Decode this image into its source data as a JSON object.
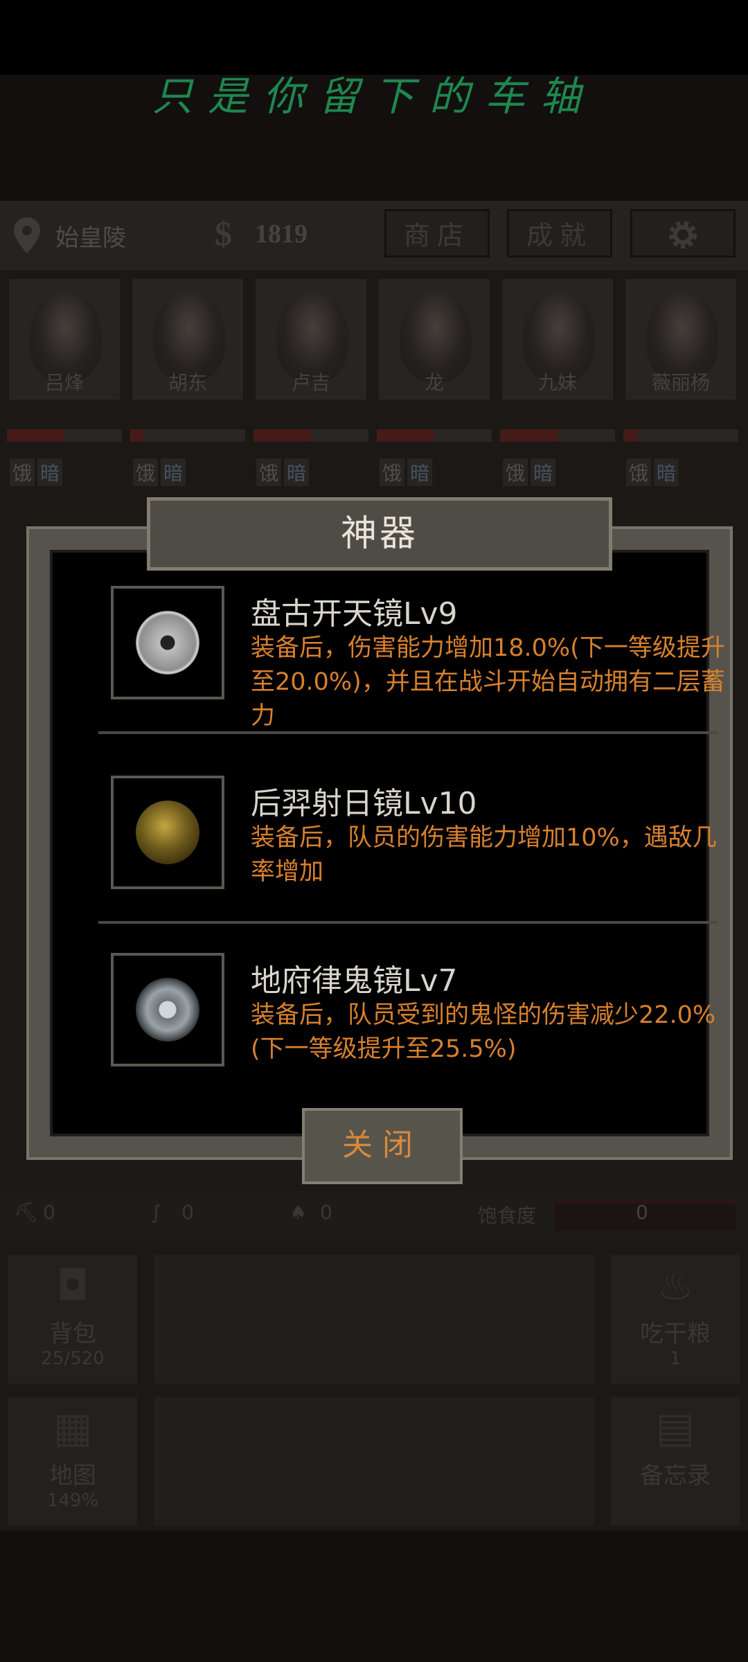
{
  "overlay_lyric": "只是你留下的车轴",
  "topbar": {
    "location": "始皇陵",
    "money_symbol": "$",
    "money": "1819",
    "shop_label": "商店",
    "achievements_label": "成就"
  },
  "characters": [
    {
      "name": "吕烽",
      "hp": 0.5,
      "tag1": "饿",
      "tag2": "暗"
    },
    {
      "name": "胡东",
      "hp": 0.12,
      "tag1": "饿",
      "tag2": "暗"
    },
    {
      "name": "卢吉",
      "hp": 0.5,
      "tag1": "饿",
      "tag2": "暗"
    },
    {
      "name": "龙",
      "hp": 0.5,
      "tag1": "饿",
      "tag2": "暗"
    },
    {
      "name": "九妹",
      "hp": 0.5,
      "tag1": "饿",
      "tag2": "暗"
    },
    {
      "name": "薇丽杨",
      "hp": 0.12,
      "tag1": "饿",
      "tag2": "暗"
    }
  ],
  "resources": {
    "tool1": "0",
    "tool2": "0",
    "tool3": "0",
    "satiety_label": "饱食度",
    "satiety": "0"
  },
  "buttons": {
    "bag": {
      "label": "背包",
      "sub": "25/520"
    },
    "eat": {
      "label": "吃干粮",
      "sub": "1"
    },
    "map": {
      "label": "地图",
      "sub": "149%"
    },
    "memo": {
      "label": "备忘录"
    }
  },
  "modal": {
    "title": "神器",
    "items": [
      {
        "name": "盘古开天镜Lv9",
        "desc": "装备后，伤害能力增加18.0%(下一等级提升至20.0%)，并且在战斗开始自动拥有二层蓄力"
      },
      {
        "name": "后羿射日镜Lv10",
        "desc": "装备后，队员的伤害能力增加10%，遇敌几率增加"
      },
      {
        "name": "地府律鬼镜Lv7",
        "desc": "装备后，队员受到的鬼怪的伤害减少22.0%(下一等级提升至25.5%)"
      }
    ],
    "close_label": "关闭"
  },
  "colors": {
    "accent_orange": "#d7802e",
    "lyric_green": "#2fd17a"
  }
}
